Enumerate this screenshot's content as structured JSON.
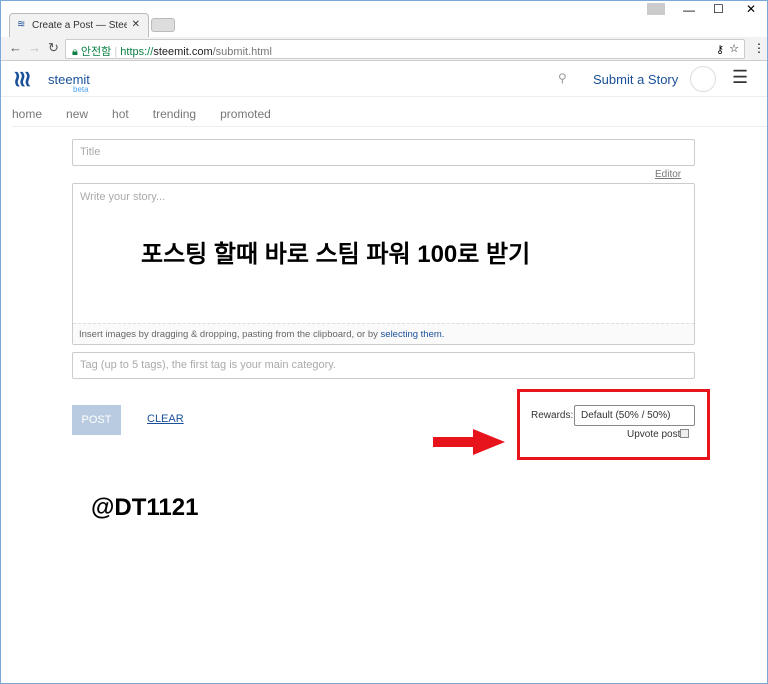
{
  "browser": {
    "tab_title": "Create a Post — Steemit",
    "secure_label": "안전함",
    "url_scheme": "https://",
    "url_domain": "steemit.com",
    "url_path": "/submit.html"
  },
  "header": {
    "logo": "steemit",
    "logo_sub": "beta",
    "submit_label": "Submit a Story"
  },
  "nav": [
    {
      "label": "home"
    },
    {
      "label": "new"
    },
    {
      "label": "hot"
    },
    {
      "label": "trending"
    },
    {
      "label": "promoted"
    }
  ],
  "form": {
    "title_placeholder": "Title",
    "editor_link": "Editor",
    "body_placeholder": "Write your story...",
    "overlay_text": "포스팅 할때 바로 스팀 파워 100로 받기",
    "upload_hint": "Insert images by dragging & dropping, pasting from the clipboard, or by ",
    "upload_link": "selecting them.",
    "tags_placeholder": "Tag (up to 5 tags), the first tag is your main category.",
    "post_label": "POST",
    "clear_label": "CLEAR",
    "rewards_label": "Rewards:",
    "rewards_value": "Default (50% / 50%)",
    "upvote_label": "Upvote post"
  },
  "annotation": {
    "author": "@DT1121",
    "highlight_color": "#e8141c"
  },
  "colors": {
    "accent": "#1a5099",
    "post_button": "#b9cbe0"
  }
}
